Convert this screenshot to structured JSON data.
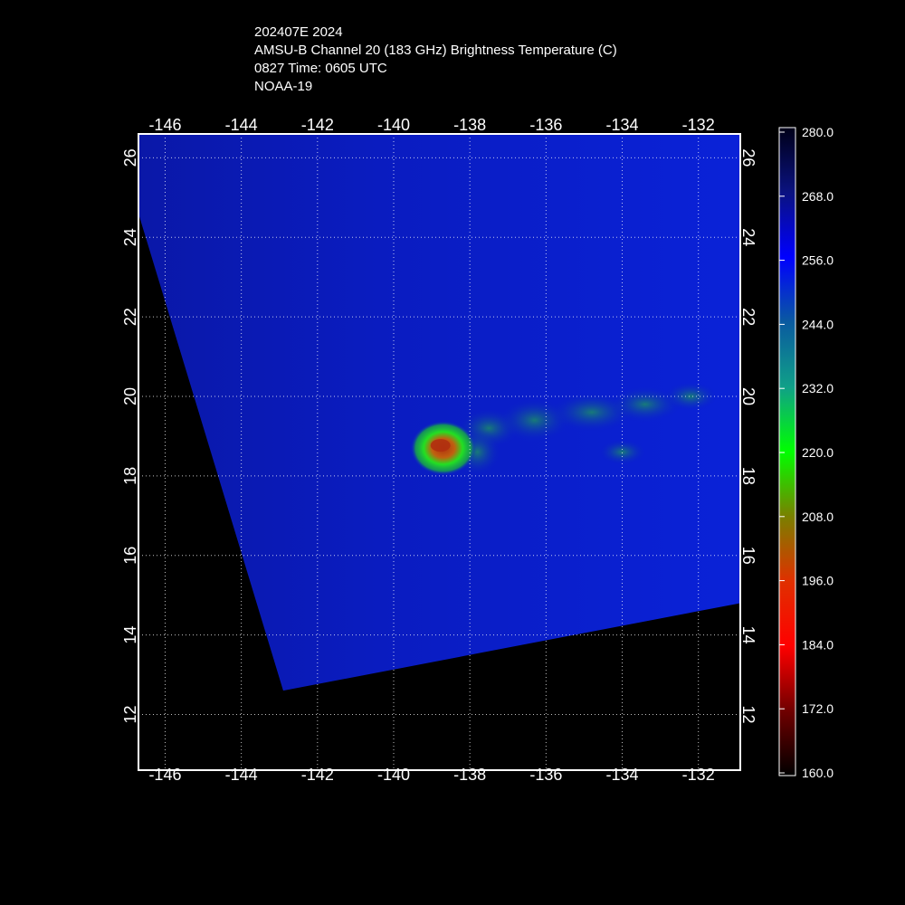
{
  "title": {
    "line1": "202407E 2024",
    "line2": "AMSU-B Channel 20 (183 GHz) Brightness Temperature (C)",
    "line3": "0827 Time: 0605 UTC",
    "line4": "NOAA-19"
  },
  "map": {
    "lon_range": [
      -146.7,
      -130.9
    ],
    "lat_range": [
      10.6,
      26.6
    ],
    "lon_ticks": [
      -146,
      -144,
      -142,
      -140,
      -138,
      -136,
      -134,
      -132
    ],
    "lon_tick_labels": [
      "-146",
      "-144",
      "-142",
      "-140",
      "-138",
      "-136",
      "-134",
      "-132"
    ],
    "lat_ticks": [
      12,
      14,
      16,
      18,
      20,
      22,
      24,
      26
    ],
    "lat_tick_labels": [
      "12",
      "14",
      "16",
      "18",
      "20",
      "22",
      "24",
      "26"
    ],
    "grid": true,
    "swath_lonlat": [
      [
        -146.7,
        26.6
      ],
      [
        -130.9,
        26.6
      ],
      [
        -130.9,
        14.8
      ],
      [
        -142.9,
        12.6
      ],
      [
        -146.7,
        24.6
      ]
    ],
    "feature": {
      "name": "cold-core",
      "center_lonlat": [
        -138.7,
        18.7
      ],
      "min_temperature": 190
    },
    "colors": {
      "background_temp": "#0a1ec8",
      "rainband": "#1a7a6a",
      "core_green": "#22e022",
      "core_red": "#b03010"
    }
  },
  "colorbar": {
    "ticks": [
      "280.0",
      "268.0",
      "256.0",
      "244.0",
      "232.0",
      "220.0",
      "208.0",
      "196.0",
      "184.0",
      "172.0",
      "160.0"
    ],
    "range": [
      160,
      280
    ],
    "stops": [
      {
        "value": 280,
        "color": "#000018"
      },
      {
        "value": 268,
        "color": "#0a1280"
      },
      {
        "value": 256,
        "color": "#0000ff"
      },
      {
        "value": 244,
        "color": "#0a5aa0"
      },
      {
        "value": 232,
        "color": "#10a088"
      },
      {
        "value": 220,
        "color": "#00ff00"
      },
      {
        "value": 208,
        "color": "#7a8000"
      },
      {
        "value": 196,
        "color": "#e03000"
      },
      {
        "value": 184,
        "color": "#ff0000"
      },
      {
        "value": 172,
        "color": "#700000"
      },
      {
        "value": 160,
        "color": "#000000"
      }
    ]
  }
}
